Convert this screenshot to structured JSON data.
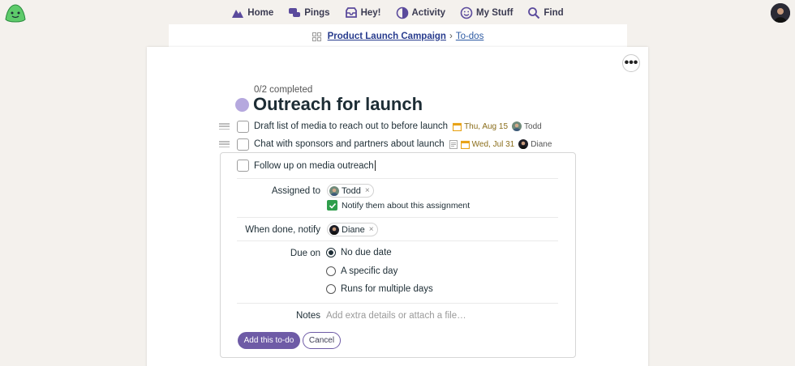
{
  "nav": {
    "items": [
      {
        "label": "Home",
        "icon": "mountain-icon"
      },
      {
        "label": "Pings",
        "icon": "chat-bubbles-icon"
      },
      {
        "label": "Hey!",
        "icon": "inbox-tray-icon"
      },
      {
        "label": "Activity",
        "icon": "pie-chart-icon"
      },
      {
        "label": "My Stuff",
        "icon": "smiley-face-icon"
      },
      {
        "label": "Find",
        "icon": "magnifier-icon"
      }
    ]
  },
  "breadcrumb": {
    "project": "Product Launch Campaign",
    "separator": "›",
    "section": "To-dos"
  },
  "list": {
    "completed": "0/2 completed",
    "title": "Outreach for launch",
    "todos": [
      {
        "text": "Draft list of media to reach out to before launch",
        "due": "Thu, Aug 15",
        "assignee": "Todd",
        "has_notes": false
      },
      {
        "text": "Chat with sponsors and partners about launch",
        "due": "Wed, Jul 31",
        "assignee": "Diane",
        "has_notes": true
      }
    ]
  },
  "form": {
    "title_value": "Follow up on media outreach",
    "assigned_label": "Assigned to",
    "assigned_chip": "Todd",
    "notify_assignment": "Notify them about this assignment",
    "when_done_label": "When done, notify",
    "notify_chip": "Diane",
    "remove_glyph": "×",
    "due_label": "Due on",
    "due_options": [
      "No due date",
      "A specific day",
      "Runs for multiple days"
    ],
    "due_selected": "No due date",
    "notes_label": "Notes",
    "notes_placeholder": "Add extra details or attach a file…",
    "submit_label": "Add this to-do",
    "cancel_label": "Cancel"
  },
  "more_button": "•••",
  "colors": {
    "accent": "#6e5ba6",
    "list_dot": "#b5a8de",
    "due_icon": "#e8a317",
    "check_green": "#2f9e4c",
    "background": "#f4f1ed"
  }
}
